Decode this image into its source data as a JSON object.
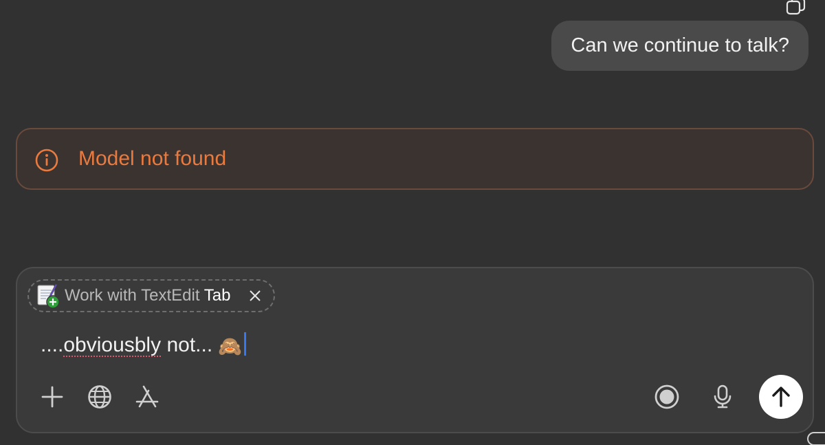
{
  "conversation": {
    "user_message": "Can we continue to talk?",
    "error_message": "Model not found"
  },
  "composer": {
    "context_chip": {
      "prefix": "Work with TextEdit",
      "tab": "Tab"
    },
    "input": {
      "prefix": "....",
      "misspelled": "obviousbly",
      "suffix": " not...",
      "emoji": "🙈"
    },
    "toolbar_icons": [
      "plus-icon",
      "globe-icon",
      "app-store-icon",
      "record-icon",
      "microphone-icon",
      "arrow-up-icon"
    ]
  },
  "colors": {
    "background": "#313131",
    "error": "#ea7a3e",
    "caret": "#3478f6"
  }
}
